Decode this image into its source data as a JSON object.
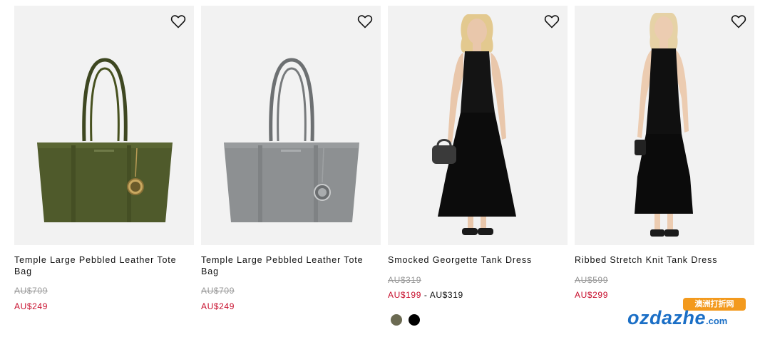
{
  "products": [
    {
      "title": "Temple Large Pebbled Leather Tote Bag",
      "original_price": "AU$709",
      "sale_price": "AU$249",
      "color": "#4f5a2b",
      "favorite_icon": "heart-outline-icon"
    },
    {
      "title": "Temple Large Pebbled Leather Tote Bag",
      "original_price": "AU$709",
      "sale_price": "AU$249",
      "color": "#8d9092",
      "favorite_icon": "heart-outline-icon"
    },
    {
      "title": "Smocked Georgette Tank Dress",
      "original_price": "AU$319",
      "sale_price": "AU$199",
      "price_separator": " - ",
      "price_range_max": "AU$319",
      "swatches": [
        {
          "name": "olive",
          "color": "#6b6a52"
        },
        {
          "name": "black",
          "color": "#000000"
        }
      ],
      "favorite_icon": "heart-outline-icon"
    },
    {
      "title": "Ribbed Stretch Knit Tank Dress",
      "original_price": "AU$599",
      "sale_price": "AU$299",
      "favorite_icon": "heart-outline-icon"
    }
  ],
  "watermark": {
    "badge": "澳洲打折网",
    "logo_main": "ozdazhe",
    "logo_domain": ".com"
  },
  "colors": {
    "sale_red": "#c8102e",
    "strike_grey": "#999999",
    "image_bg": "#f2f2f2",
    "watermark_orange": "#f39a1e",
    "watermark_blue": "#1b6fc6"
  }
}
